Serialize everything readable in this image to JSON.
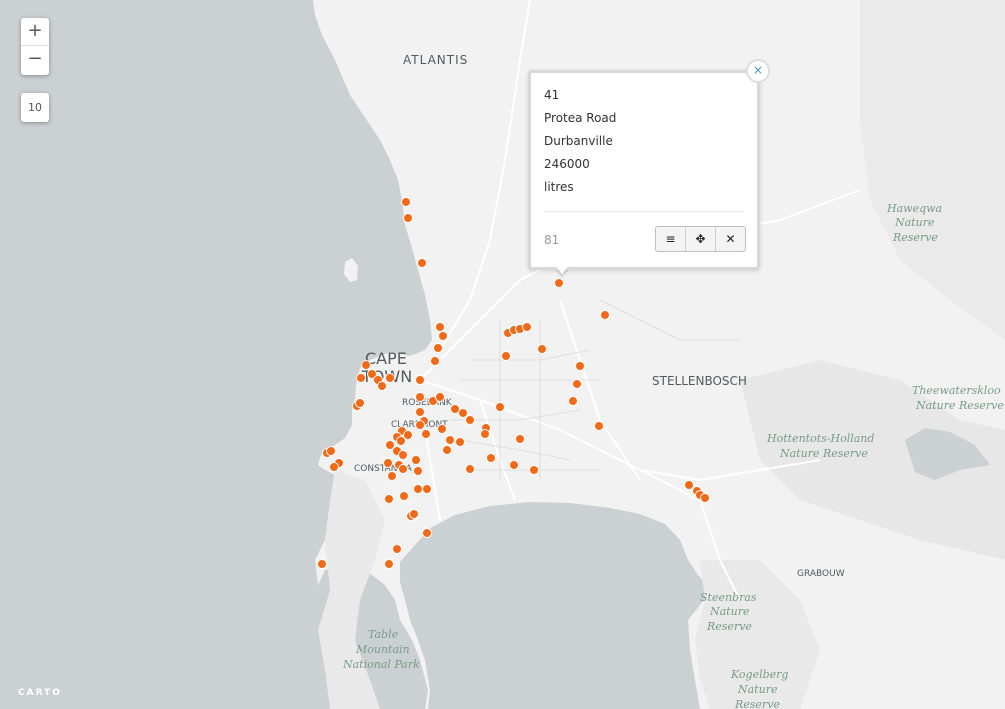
{
  "zoom": {
    "in_label": "+",
    "out_label": "−",
    "level": "10"
  },
  "labels": {
    "atlantis": "ATLANTIS",
    "cape": "CAPE",
    "town": "TOWN",
    "rosebank": "ROSEBANK",
    "claremont": "CLAREMONT",
    "constantia": "CONSTANTIA",
    "stellenbosch": "STELLENBOSCH",
    "grabouw": "GRABOUW",
    "haweqwa": [
      "Haweqwa",
      "Nature",
      "Reserve"
    ],
    "theewaterskloof": [
      "Theewaterskloo",
      "Nature Reserve"
    ],
    "hottentots": [
      "Hottentots-Holland",
      "Nature Reserve"
    ],
    "steenbras": [
      "Steenbras",
      "Nature",
      "Reserve"
    ],
    "table_mountain": [
      "Table",
      "Mountain",
      "National Park"
    ],
    "kogelberg": [
      "Kogelberg",
      "Nature",
      "Reserve"
    ]
  },
  "popup": {
    "lines": [
      "41",
      "Protea Road",
      "Durbanville",
      "246000",
      "litres"
    ],
    "count": "81",
    "tools": {
      "list": "≡",
      "move": "✥",
      "close": "✕"
    },
    "close_label": "×"
  },
  "logo": "CARTO",
  "colors": {
    "water": "#cbd0d3",
    "land": "#f2f2f2",
    "marker": "#f26a17"
  }
}
